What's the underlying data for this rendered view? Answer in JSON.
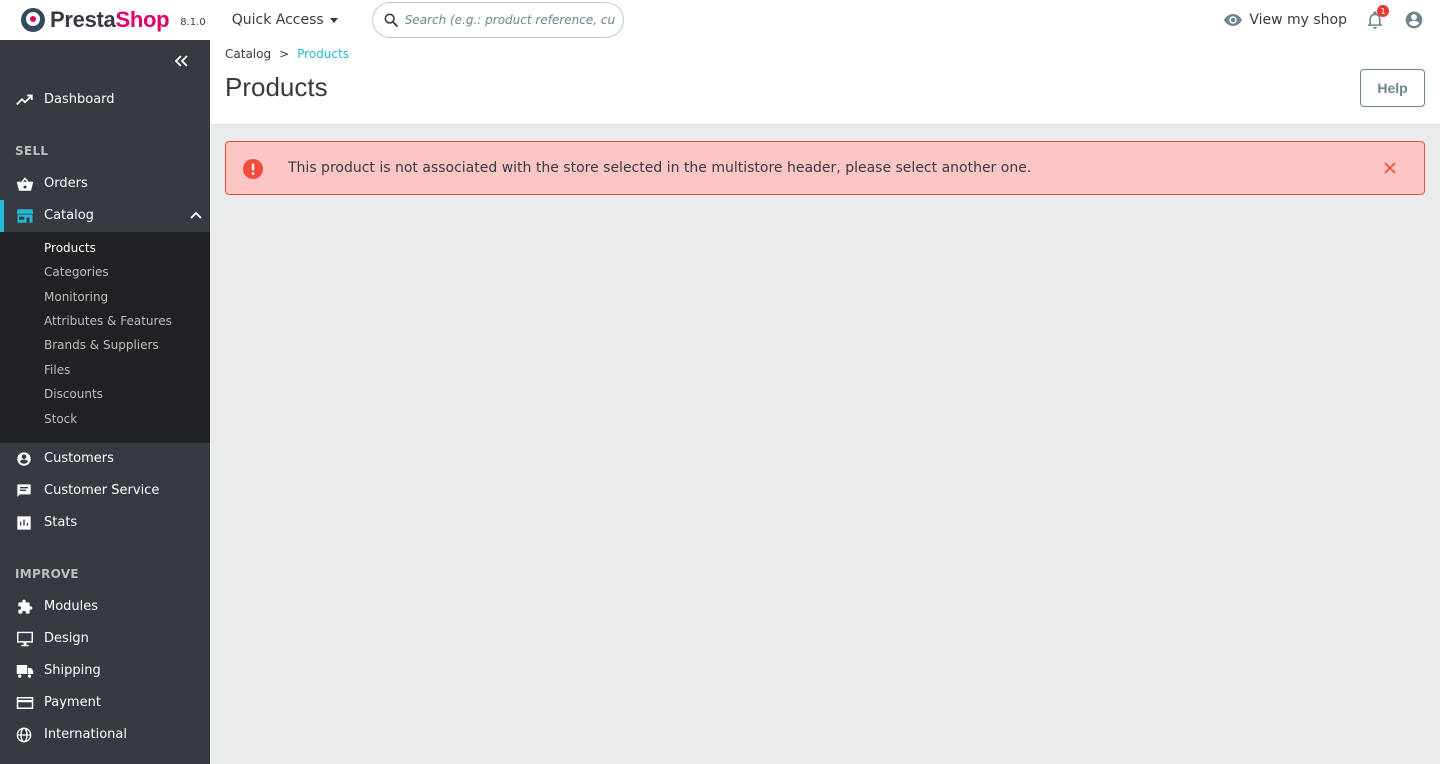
{
  "header": {
    "brand_presta": "Presta",
    "brand_shop": "Shop",
    "version": "8.1.0",
    "quick_access": "Quick Access",
    "search_placeholder": "Search (e.g.: product reference, custon",
    "view_shop": "View my shop",
    "notifications_count": "1"
  },
  "sidebar": {
    "dashboard": "Dashboard",
    "sell_title": "SELL",
    "orders": "Orders",
    "catalog": "Catalog",
    "catalog_sub": [
      "Products",
      "Categories",
      "Monitoring",
      "Attributes & Features",
      "Brands & Suppliers",
      "Files",
      "Discounts",
      "Stock"
    ],
    "customers": "Customers",
    "customer_service": "Customer Service",
    "stats": "Stats",
    "improve_title": "IMPROVE",
    "modules": "Modules",
    "design": "Design",
    "shipping": "Shipping",
    "payment": "Payment",
    "international": "International"
  },
  "content": {
    "breadcrumb": [
      "Catalog",
      "Products"
    ],
    "breadcrumb_sep": ">",
    "title": "Products",
    "help": "Help",
    "alert_text": "This product is not associated with the store selected in the multistore header, please select another one."
  },
  "colors": {
    "sidebar_bg": "#363a41",
    "submenu_bg": "#202226",
    "accent": "#25b9d7",
    "brand": "#df0067",
    "alert_bg": "#fbc6c3",
    "alert_border": "#f54c3e"
  }
}
